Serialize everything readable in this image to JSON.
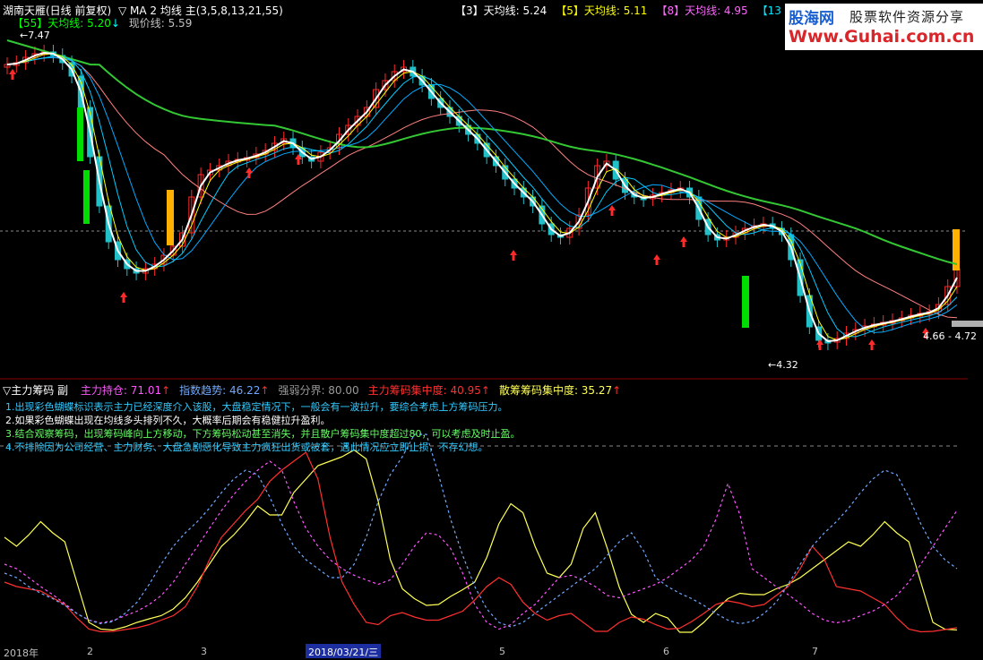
{
  "window": {
    "title": "湖南天雁(日线 前复权)",
    "ma_indicator": "▽ MA 2 均线 主(3,5,8,13,21,55)"
  },
  "ma_legend": [
    {
      "label": "【3】天均线: 5.24",
      "color": "#ffffff"
    },
    {
      "label": "【5】天均线: 5.11",
      "color": "#ffff00"
    },
    {
      "label": "【8】天均线: 4.95",
      "color": "#ff66ff"
    },
    {
      "label": "【13",
      "color": "#00e5ff"
    }
  ],
  "ma55_legend": {
    "label": "【55】天均线: 5.20",
    "color": "#00ff00",
    "arrow": "↓"
  },
  "current_price": {
    "label": "现价线: 5.59",
    "color": "#c0c0c0"
  },
  "logo": {
    "brand": "股海网",
    "slogan": "股票软件资源分享",
    "url": "Www.Guhai.com.cn"
  },
  "price_annotations": {
    "high": "7.47",
    "low": "4.32",
    "range": "4.66 - 4.72"
  },
  "sub_chart": {
    "title": "▽主力筹码 副",
    "metrics": [
      {
        "label": "主力持仓: 71.01",
        "arrow": "↑",
        "color": "#ff55ff"
      },
      {
        "label": "指数趋势: 46.22",
        "arrow": "↑",
        "color": "#6fa8ff"
      },
      {
        "label": "强弱分界: 80.00",
        "arrow": "",
        "color": "#9a9a9a"
      },
      {
        "label": "主力筹码集中度: 40.95",
        "arrow": "↑",
        "color": "#ff3030"
      },
      {
        "label": "散筹筹码集中度: 35.27",
        "arrow": "↑",
        "color": "#ffff55"
      }
    ],
    "tips": [
      {
        "text": "1.出现彩色蝴蝶标识表示主力已经深度介入该股，大盘稳定情况下，一般会有一波拉升，要综合考虑上方筹码压力。",
        "color": "#33ccff"
      },
      {
        "text": "2.如果彩色蝴蝶出现在均线多头排列不久，大概率后期会有稳健拉升盈利。",
        "color": "#ffffff"
      },
      {
        "text": "3.结合观察筹码，出现筹码峰向上方移动，下方筹码松动甚至消失，并且散户筹码集中度超过80，可以考虑及时止盈。",
        "color": "#66ff66"
      },
      {
        "text": "4.不排除因为公司经营、主力财务、大盘急剧恶化导致主力疯狂出货或被套，遇此情况应立即止损，不存幻想。",
        "color": "#33ccff"
      }
    ]
  },
  "date_axis": {
    "labels": [
      "2018年",
      "2",
      "3",
      "5",
      "6",
      "7"
    ],
    "selected": "2018/03/21/三"
  },
  "colors": {
    "up": "#ff2a2a",
    "down": "#22c0c8",
    "ma55": "#33c833",
    "ma3": "#ffffff",
    "ma5": "#ffff00",
    "ma8": "#00ccff",
    "ma13": "#00aaff",
    "ma21": "#ff8080"
  }
}
